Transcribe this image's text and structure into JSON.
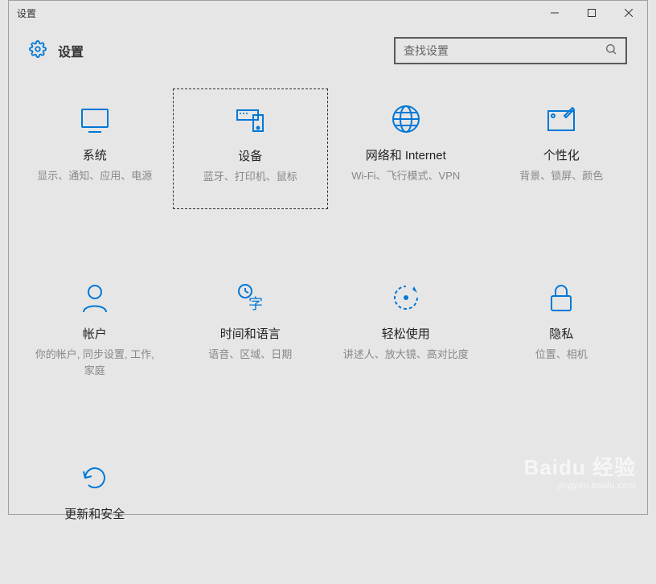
{
  "window": {
    "title": "设置"
  },
  "header": {
    "title": "设置"
  },
  "search": {
    "placeholder": "查找设置"
  },
  "tiles": {
    "system": {
      "title": "系统",
      "desc": "显示、通知、应用、电源"
    },
    "devices": {
      "title": "设备",
      "desc": "蓝牙、打印机、鼠标"
    },
    "network": {
      "title": "网络和 Internet",
      "desc": "Wi-Fi、飞行模式、VPN"
    },
    "personalization": {
      "title": "个性化",
      "desc": "背景、锁屏、颜色"
    },
    "accounts": {
      "title": "帐户",
      "desc": "你的帐户, 同步设置, 工作, 家庭"
    },
    "time_language": {
      "title": "时间和语言",
      "desc": "语音、区域、日期"
    },
    "ease_of_access": {
      "title": "轻松使用",
      "desc": "讲述人、放大镜、高对比度"
    },
    "privacy": {
      "title": "隐私",
      "desc": "位置、相机"
    },
    "update_security": {
      "title": "更新和安全",
      "desc": ""
    }
  },
  "watermark": {
    "main": "Baidu 经验",
    "sub": "jingyan.baidu.com"
  }
}
